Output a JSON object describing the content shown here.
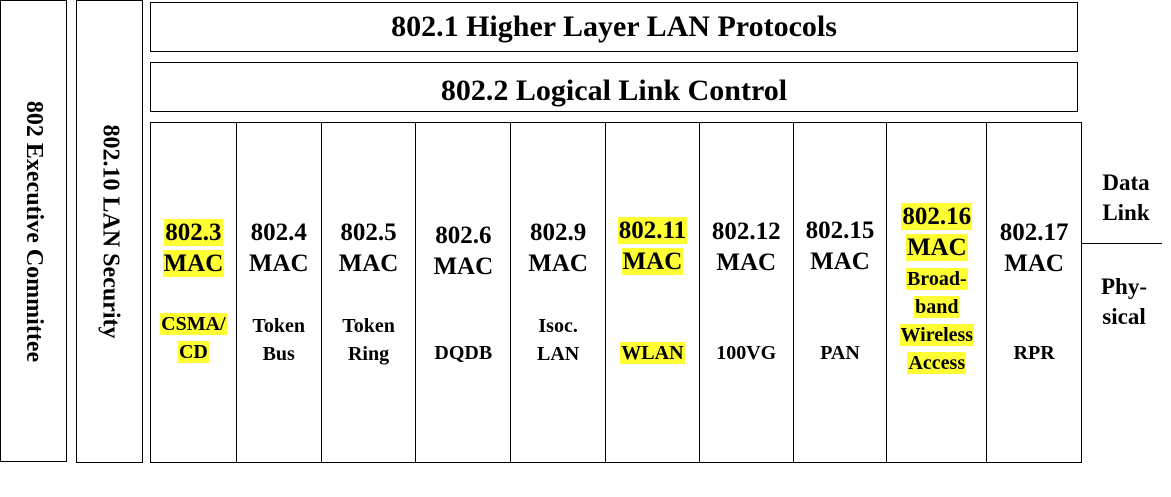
{
  "vertical_labels": {
    "executive": "802 Executive Committee",
    "security": "802.10  LAN Security"
  },
  "bars": {
    "higher": "802.1 Higher Layer LAN Protocols",
    "llc": "802.2 Logical Link Control"
  },
  "columns": [
    {
      "num": "802.3",
      "mac": "MAC",
      "sub": [
        "CSMA/",
        "CD"
      ],
      "highlight_head": true,
      "highlight_sub": true
    },
    {
      "num": "802.4",
      "mac": "MAC",
      "sub": [
        "Token",
        "Bus"
      ],
      "highlight_head": false,
      "highlight_sub": false
    },
    {
      "num": "802.5",
      "mac": "MAC",
      "sub": [
        "Token",
        "Ring"
      ],
      "highlight_head": false,
      "highlight_sub": false
    },
    {
      "num": "802.6",
      "mac": "MAC",
      "sub": [
        "DQDB"
      ],
      "highlight_head": false,
      "highlight_sub": false
    },
    {
      "num": "802.9",
      "mac": "MAC",
      "sub": [
        "Isoc.",
        "LAN"
      ],
      "highlight_head": false,
      "highlight_sub": false
    },
    {
      "num": "802.11",
      "mac": "MAC",
      "sub": [
        "WLAN"
      ],
      "highlight_head": true,
      "highlight_sub": true
    },
    {
      "num": "802.12",
      "mac": "MAC",
      "sub": [
        "100VG"
      ],
      "highlight_head": false,
      "highlight_sub": false
    },
    {
      "num": "802.15",
      "mac": "MAC",
      "sub": [
        "PAN"
      ],
      "highlight_head": false,
      "highlight_sub": false
    },
    {
      "num": "802.16",
      "mac": "MAC",
      "sub": [
        "Broad-",
        "band",
        "Wireless",
        "Access"
      ],
      "highlight_head": true,
      "highlight_sub": true
    },
    {
      "num": "802.17",
      "mac": "MAC",
      "sub": [
        "RPR"
      ],
      "highlight_head": false,
      "highlight_sub": false
    }
  ],
  "side_labels": {
    "data_link": [
      "Data",
      "Link"
    ],
    "physical": [
      "Phy-",
      "sical"
    ]
  },
  "colors": {
    "highlight": "#ffff33",
    "line": "#000000"
  }
}
